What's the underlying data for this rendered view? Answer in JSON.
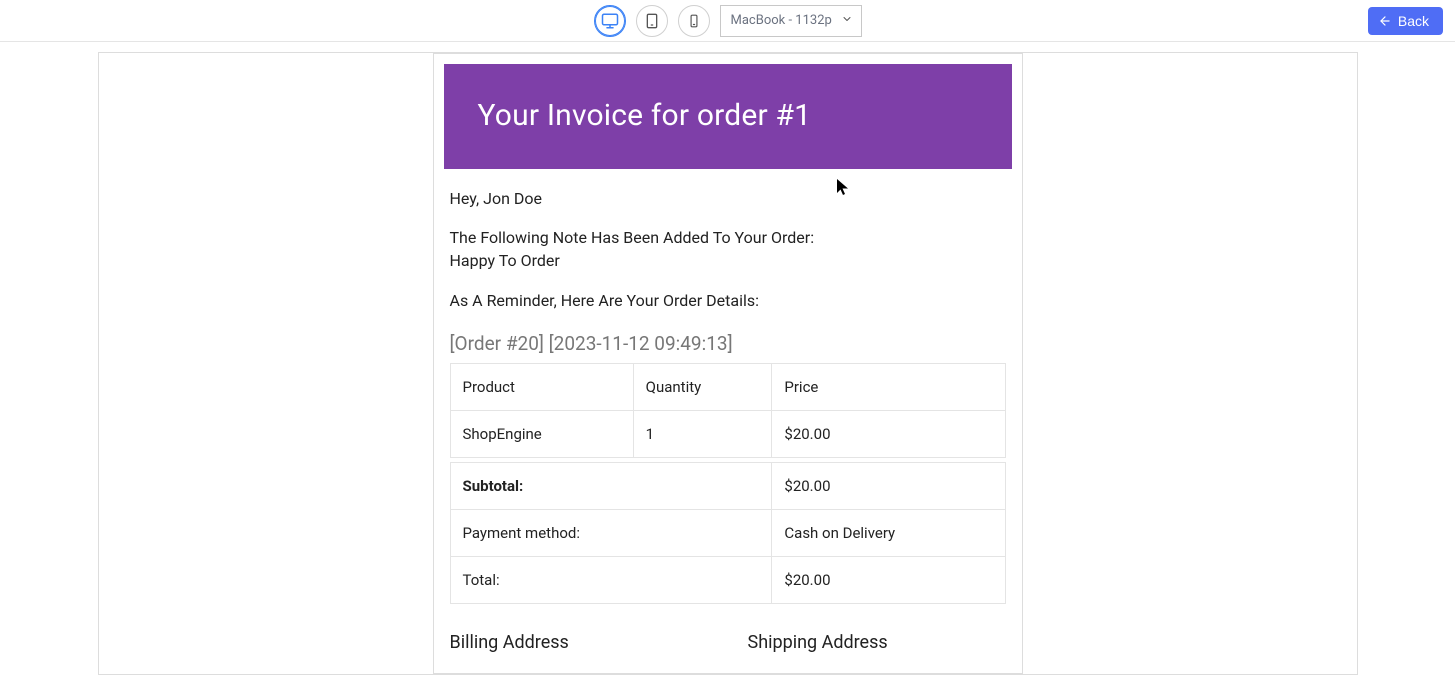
{
  "toolbar": {
    "device_select_value": "MacBook - 1132p",
    "back_label": "Back"
  },
  "invoice": {
    "title": "Your Invoice for order #1",
    "greeting": "Hey, Jon Doe",
    "note_intro": "The Following Note Has Been Added To Your Order:",
    "note_body": "Happy To Order",
    "reminder": "As A Reminder, Here Are Your Order Details:",
    "order_meta": "[Order #20] [2023-11-12 09:49:13]",
    "table": {
      "headers": {
        "product": "Product",
        "quantity": "Quantity",
        "price": "Price"
      },
      "row": {
        "product": "ShopEngine",
        "quantity": "1",
        "price": "$20.00"
      }
    },
    "summary": {
      "subtotal_label": "Subtotal:",
      "subtotal_value": "$20.00",
      "payment_label": "Payment method:",
      "payment_value": "Cash on Delivery",
      "total_label": "Total:",
      "total_value": "$20.00"
    },
    "addresses": {
      "billing_title": "Billing Address",
      "shipping_title": "Shipping Address"
    }
  }
}
